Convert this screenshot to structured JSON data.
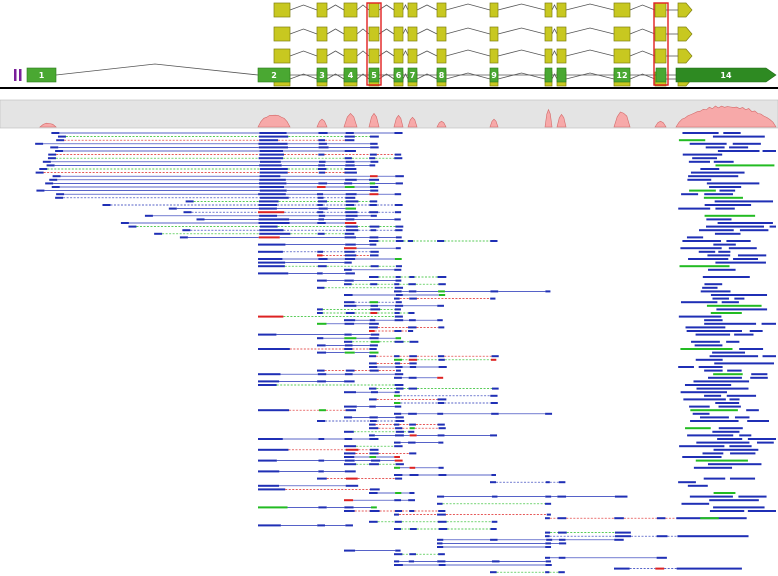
{
  "exon_numbers": [
    "1",
    "2",
    "3",
    "4",
    "5",
    "6",
    "7",
    "8",
    "9",
    "12",
    "14"
  ],
  "colors": {
    "isoform_fill": "#c8c820",
    "isoform_stroke": "#808010",
    "gene_fill": "#4aa832",
    "gene_dark": "#2e8a22",
    "utr_purple": "#7a1f9a",
    "highlight": "#e02020",
    "coverage_bg": "#e4e4e4",
    "coverage_fill": "#f7a9a9",
    "coverage_stroke": "#d46a6a",
    "read_blue": "#1f2fb5",
    "read_red": "#dd2222",
    "read_green": "#22bb22"
  }
}
